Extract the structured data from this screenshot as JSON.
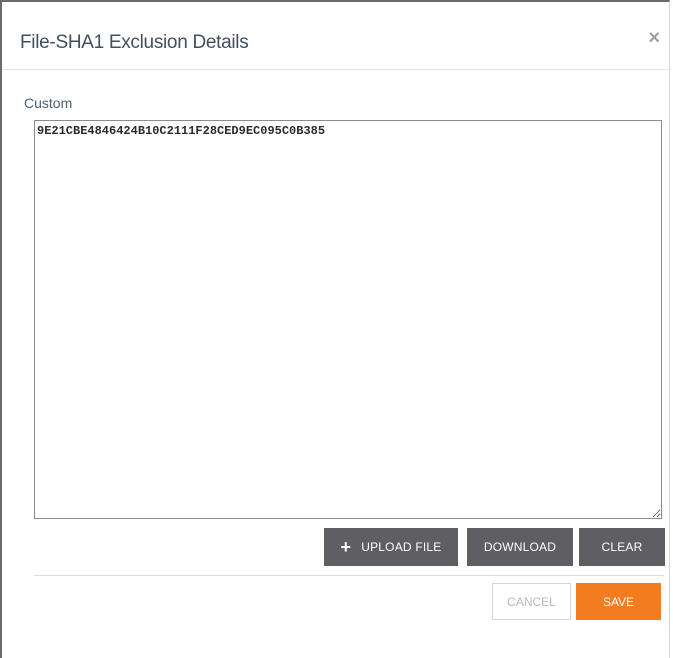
{
  "dialog": {
    "title": "File-SHA1 Exclusion Details",
    "close_icon": "×"
  },
  "custom_field": {
    "label": "Custom",
    "value": "9E21CBE4846424B10C2111F28CED9EC095C0B385"
  },
  "file_actions": {
    "upload_icon": "+",
    "upload_label": "UPLOAD FILE",
    "download_label": "DOWNLOAD",
    "clear_label": "CLEAR"
  },
  "footer": {
    "cancel_label": "CANCEL",
    "save_label": "SAVE"
  },
  "colors": {
    "accent": "#f47c20",
    "button_dark": "#5f5f63",
    "title_text": "#41505c"
  }
}
